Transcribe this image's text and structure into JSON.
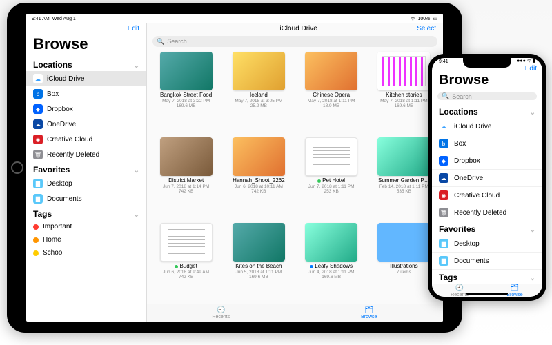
{
  "status": {
    "time": "9:41 AM",
    "date": "Wed Aug 1",
    "battery": "100%"
  },
  "sidebar": {
    "edit": "Edit",
    "title": "Browse",
    "sections": {
      "locations": "Locations",
      "favorites": "Favorites",
      "tags": "Tags"
    },
    "locations": [
      {
        "label": "iCloud Drive",
        "icon": "icloud",
        "color": "#3aa1ff",
        "active": true
      },
      {
        "label": "Box",
        "icon": "box",
        "color": "#0073e6"
      },
      {
        "label": "Dropbox",
        "icon": "dropbox",
        "color": "#0062ff"
      },
      {
        "label": "OneDrive",
        "icon": "onedrive",
        "color": "#0948a5"
      },
      {
        "label": "Creative Cloud",
        "icon": "cc",
        "color": "#da1f26"
      },
      {
        "label": "Recently Deleted",
        "icon": "trash",
        "color": "#8e8e93"
      }
    ],
    "favorites": [
      {
        "label": "Desktop",
        "icon": "folder",
        "color": "#5ac8fa"
      },
      {
        "label": "Documents",
        "icon": "folder",
        "color": "#5ac8fa"
      }
    ],
    "tags": [
      {
        "label": "Important",
        "color": "#ff3b30"
      },
      {
        "label": "Home",
        "color": "#ff9500"
      },
      {
        "label": "School",
        "color": "#ffcc00"
      }
    ]
  },
  "main": {
    "title": "iCloud Drive",
    "select": "Select",
    "search_placeholder": "Search",
    "files": [
      {
        "name": "Bangkok Street Food",
        "meta1": "May 7, 2018 at 3:22 PM",
        "meta2": "169.6 MB",
        "thumb": "img1"
      },
      {
        "name": "Iceland",
        "meta1": "May 7, 2018 at 3:05 PM",
        "meta2": "25.2 MB",
        "thumb": "img5"
      },
      {
        "name": "Chinese Opera",
        "meta1": "May 7, 2018 at 1:11 PM",
        "meta2": "18.9 MB",
        "thumb": "img2"
      },
      {
        "name": "Kitchen stories",
        "meta1": "May 7, 2018 at 1:11 PM",
        "meta2": "169.6 MB",
        "thumb": "img4"
      },
      {
        "name": "District Market",
        "meta1": "Jun 7, 2018 at 1:14 PM",
        "meta2": "742 KB",
        "thumb": "img3"
      },
      {
        "name": "Hannah_Shoot_2262",
        "meta1": "Jun 6, 2018 at 10:11 AM",
        "meta2": "742 KB",
        "thumb": "img2"
      },
      {
        "name": "Pet Hotel",
        "meta1": "Jun 7, 2018 at 1:11 PM",
        "meta2": "253 KB",
        "thumb": "doc",
        "tag": "#34c759"
      },
      {
        "name": "Summer Garden P…",
        "meta1": "Feb 14, 2018 at 1:11 PM",
        "meta2": "535 KB",
        "thumb": "img6"
      },
      {
        "name": "Budget",
        "meta1": "Jun 6, 2018 at 9:49 AM",
        "meta2": "742 KB",
        "thumb": "doc",
        "tag": "#34c759"
      },
      {
        "name": "Kites on the Beach",
        "meta1": "Jun 5, 2018 at 1:11 PM",
        "meta2": "169.6 MB",
        "thumb": "img1"
      },
      {
        "name": "Leafy Shadows",
        "meta1": "Jun 4, 2018 at 1:11 PM",
        "meta2": "169.6 MB",
        "thumb": "img6",
        "tag": "#007aff"
      },
      {
        "name": "Illustrations",
        "meta1": "7 items",
        "meta2": "",
        "thumb": "folder"
      }
    ]
  },
  "tabs": {
    "recents": "Recents",
    "browse": "Browse"
  },
  "phone": {
    "time": "9:41",
    "edit": "Edit"
  }
}
